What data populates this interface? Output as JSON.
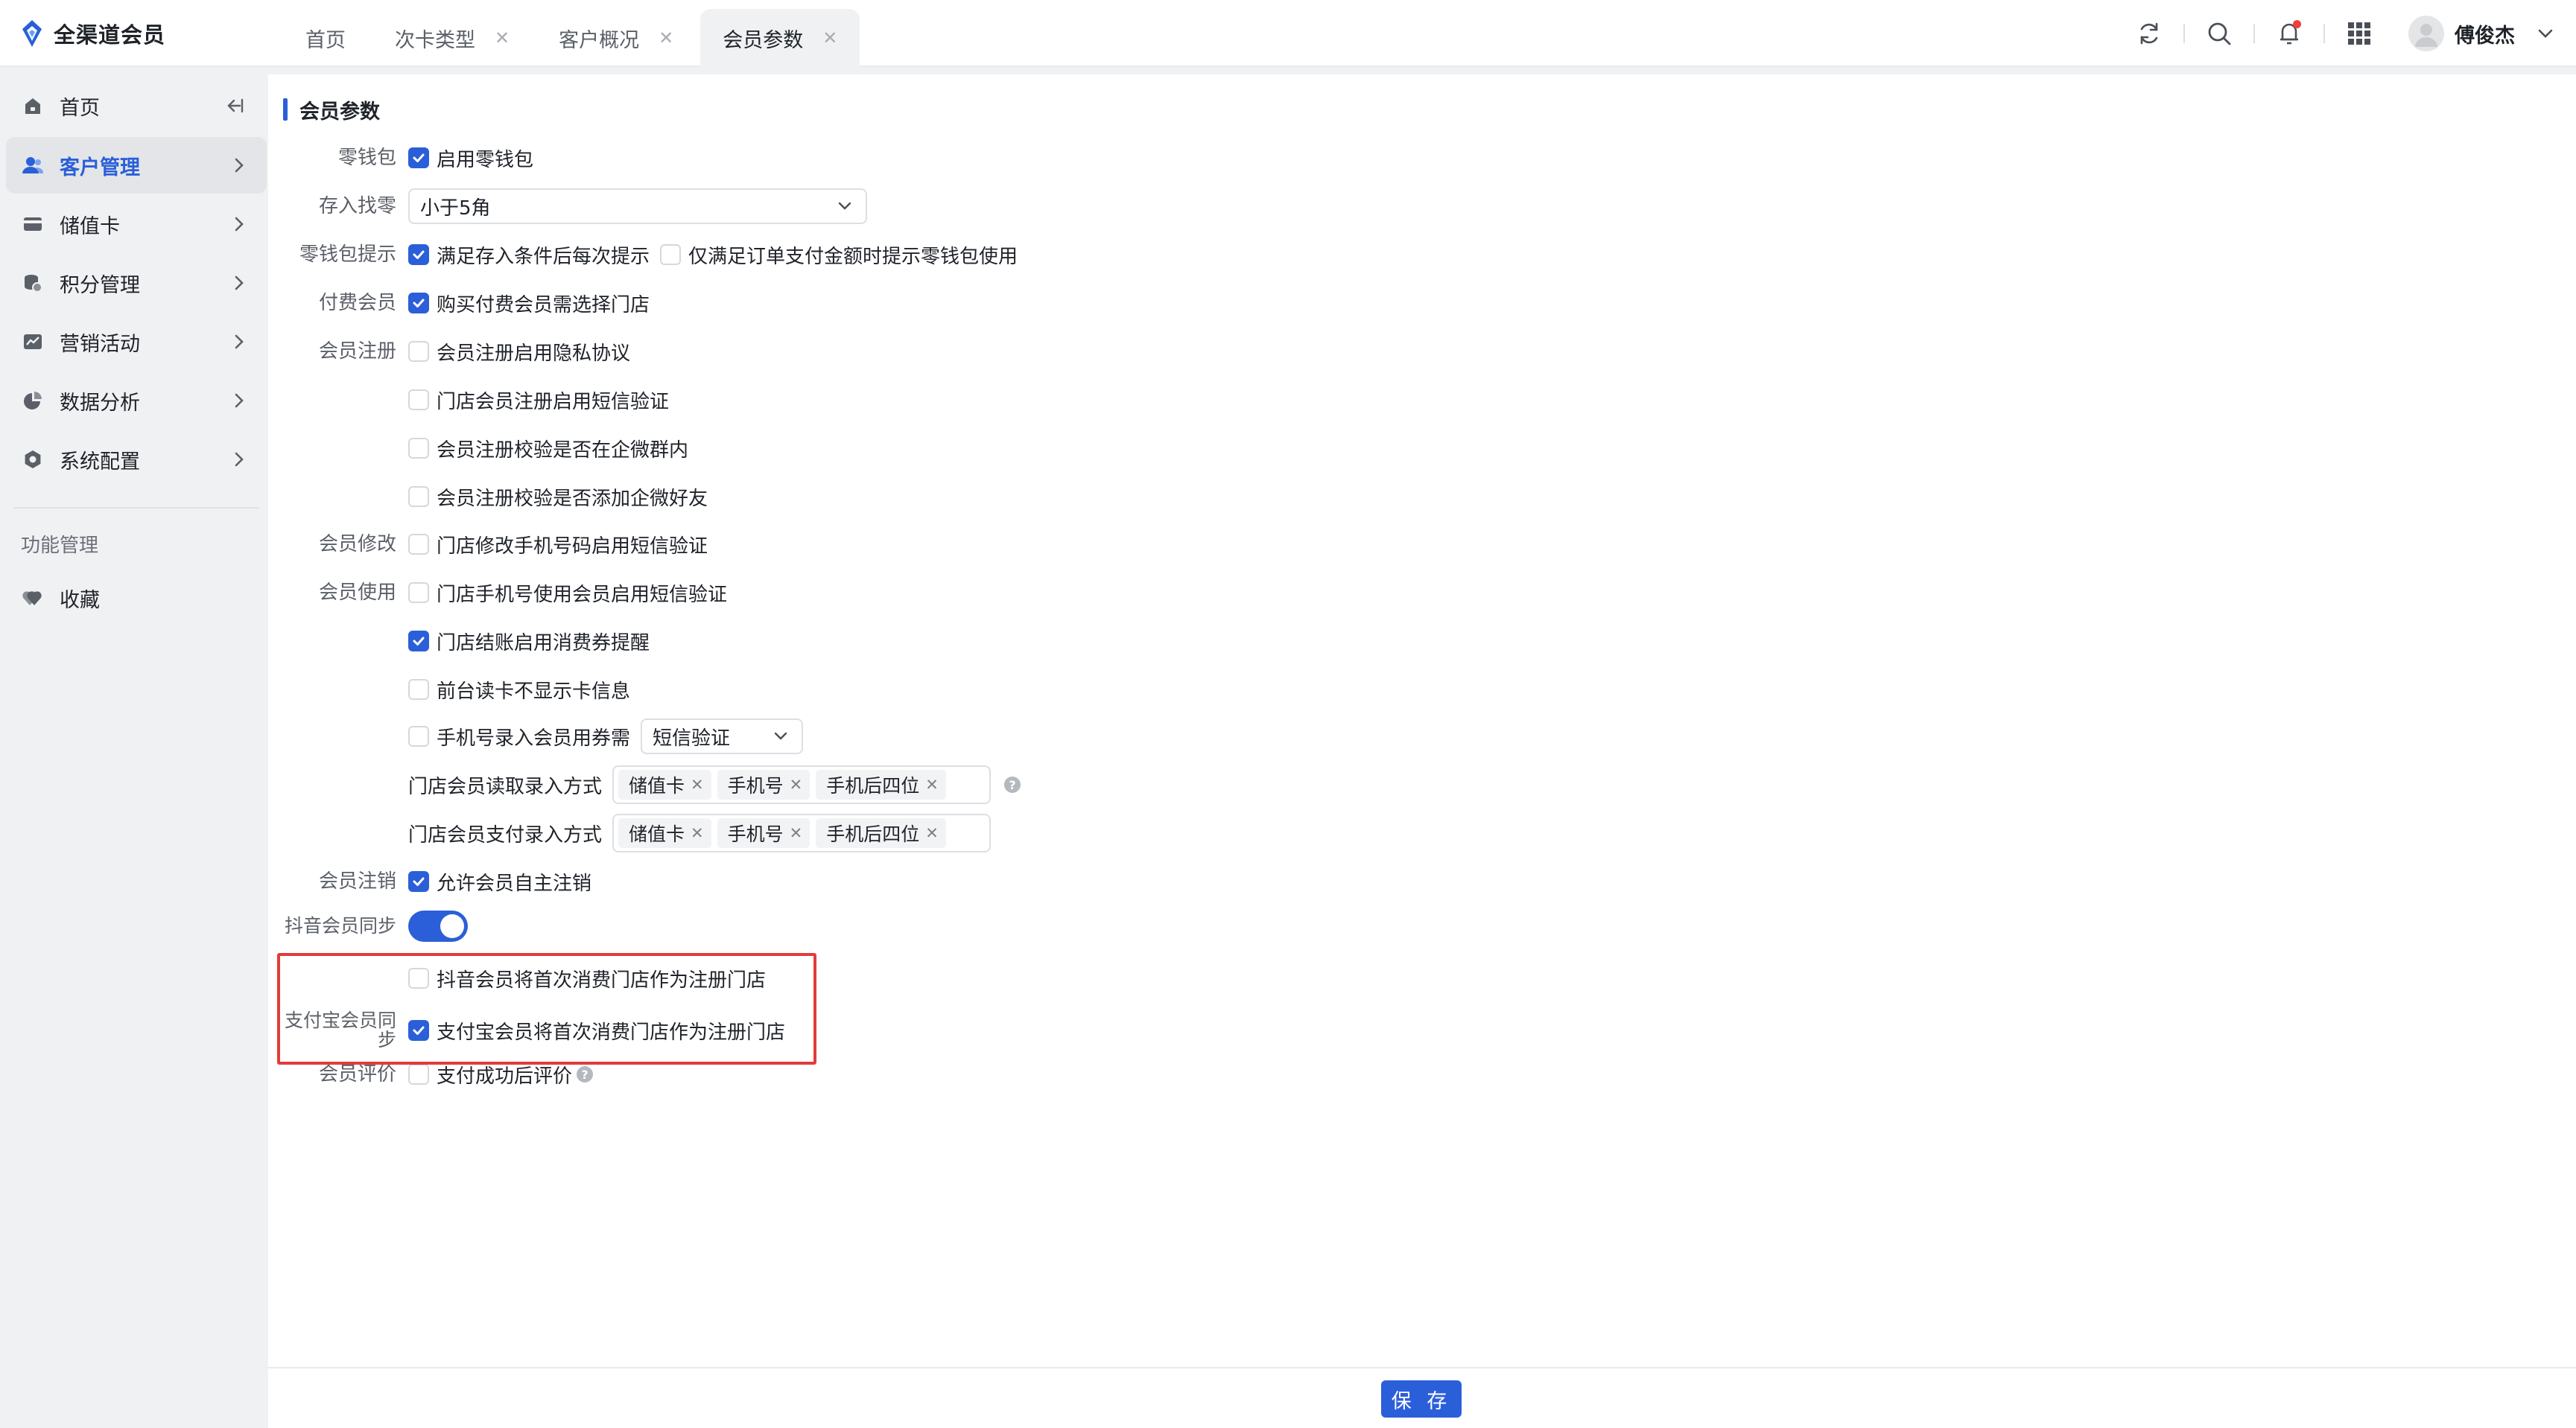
{
  "brand": {
    "name": "全渠道会员"
  },
  "tabs": [
    {
      "label": "首页",
      "closable": false,
      "active": false
    },
    {
      "label": "次卡类型",
      "closable": true,
      "active": false
    },
    {
      "label": "客户概况",
      "closable": true,
      "active": false
    },
    {
      "label": "会员参数",
      "closable": true,
      "active": true
    }
  ],
  "user": {
    "name": "傅俊杰"
  },
  "sidebar": {
    "items": [
      {
        "label": "首页",
        "icon": "home-icon"
      },
      {
        "label": "客户管理",
        "icon": "user-icon",
        "active": true
      },
      {
        "label": "储值卡",
        "icon": "card-icon"
      },
      {
        "label": "积分管理",
        "icon": "points-icon"
      },
      {
        "label": "营销活动",
        "icon": "chart-icon"
      },
      {
        "label": "数据分析",
        "icon": "pie-icon"
      },
      {
        "label": "系统配置",
        "icon": "settings-icon"
      }
    ],
    "section_title": "功能管理",
    "favorites": "收藏"
  },
  "page": {
    "title": "会员参数"
  },
  "form": {
    "wallet": {
      "label": "零钱包",
      "opt": "启用零钱包",
      "checked": true
    },
    "change": {
      "label": "存入找零",
      "value": "小于5角"
    },
    "wallet_tip": {
      "label": "零钱包提示",
      "opt1": "满足存入条件后每次提示",
      "opt1_checked": true,
      "opt2": "仅满足订单支付金额时提示零钱包使用",
      "opt2_checked": false
    },
    "paid": {
      "label": "付费会员",
      "opt": "购买付费会员需选择门店",
      "checked": true
    },
    "register": {
      "label": "会员注册",
      "opts": [
        "会员注册启用隐私协议",
        "门店会员注册启用短信验证",
        "会员注册校验是否在企微群内",
        "会员注册校验是否添加企微好友"
      ]
    },
    "modify": {
      "label": "会员修改",
      "opt": "门店修改手机号码启用短信验证"
    },
    "use": {
      "label": "会员使用",
      "opt1": "门店手机号使用会员启用短信验证",
      "opt2": "门店结账启用消费券提醒",
      "opt3": "前台读卡不显示卡信息",
      "opt4": "手机号录入会员用券需",
      "opt4_select": "短信验证",
      "read_label": "门店会员读取录入方式",
      "pay_label": "门店会员支付录入方式",
      "tags": [
        "储值卡",
        "手机号",
        "手机后四位"
      ]
    },
    "cancel": {
      "label": "会员注销",
      "opt": "允许会员自主注销",
      "checked": true
    },
    "douyin_sync": {
      "label": "抖音会员同步",
      "enabled": true
    },
    "douyin_opt": {
      "opt": "抖音会员将首次消费门店作为注册门店",
      "checked": false
    },
    "alipay": {
      "label": "支付宝会员同步",
      "opt": "支付宝会员将首次消费门店作为注册门店",
      "checked": true
    },
    "review": {
      "label": "会员评价",
      "opt": "支付成功后评价",
      "checked": false
    }
  },
  "footer": {
    "save_label": "保 存"
  },
  "colors": {
    "primary": "#2b5fd9",
    "highlight": "#e23b3b"
  }
}
